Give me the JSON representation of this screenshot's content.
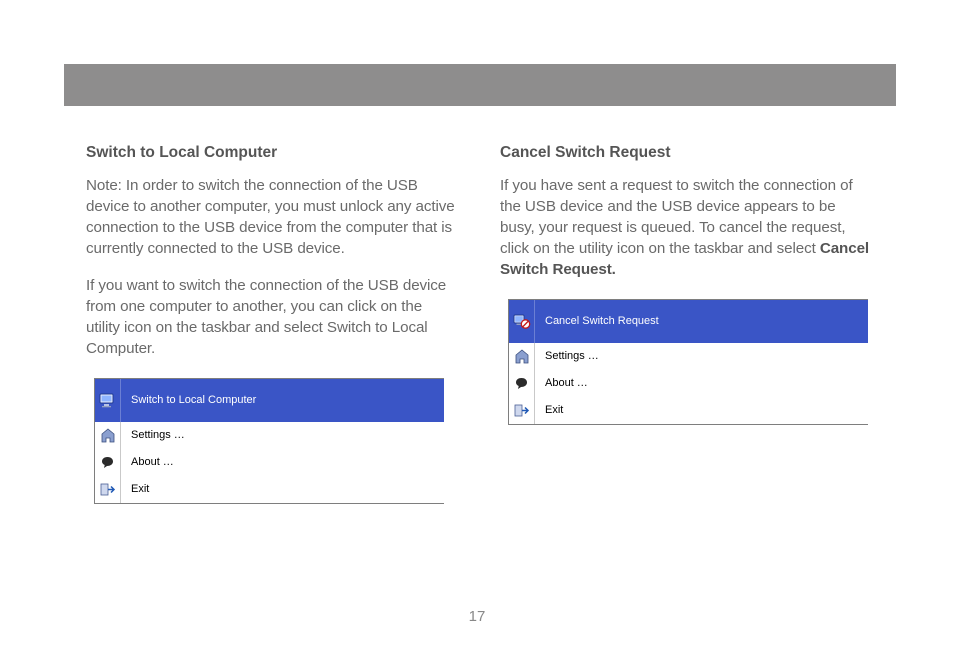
{
  "page_number": "17",
  "left": {
    "heading": "Switch to Local Computer",
    "para1": "Note: In order to switch the connection of the USB device to another computer, you must unlock any active connection to the USB device from the computer that is currently connected to the USB device.",
    "para2": "If you want to switch the connection of the USB device from one computer to another, you can click on the utility icon on the taskbar and select Switch to Local Computer.",
    "menu": {
      "item1": "Switch to Local Computer",
      "item2": "Settings …",
      "item3": "About …",
      "item4": "Exit"
    }
  },
  "right": {
    "heading": "Cancel Switch Request",
    "para1a": "If you have sent a request to switch the connection of the USB device and the USB device appears to be busy, your request is queued.  To cancel the request, click on the utility icon on the taskbar and select ",
    "para1b": "Cancel Switch Request.",
    "menu": {
      "item1": "Cancel Switch Request",
      "item2": "Settings …",
      "item3": "About …",
      "item4": "Exit"
    }
  }
}
